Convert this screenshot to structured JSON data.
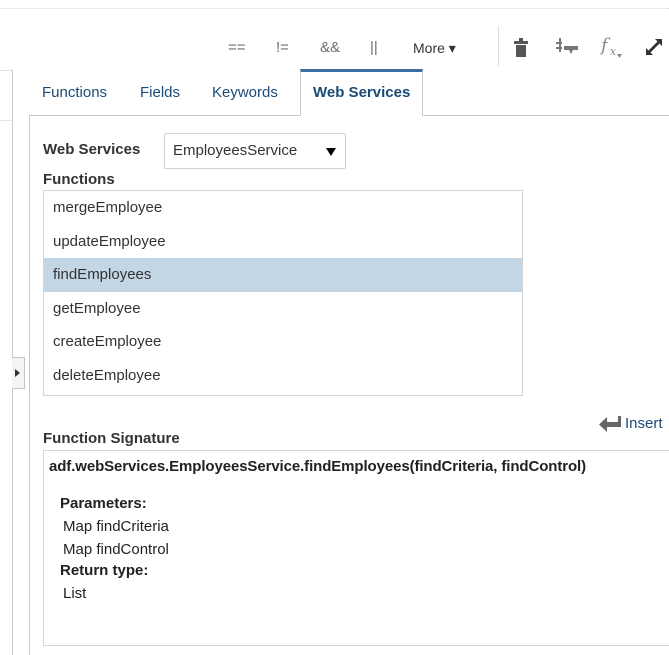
{
  "toolbar": {
    "eq": "==",
    "neq": "!=",
    "and": "&&",
    "or": "||",
    "more_label": "More ▾"
  },
  "tabs": [
    {
      "label": "Functions",
      "active": false
    },
    {
      "label": "Fields",
      "active": false
    },
    {
      "label": "Keywords",
      "active": false
    },
    {
      "label": "Web Services",
      "active": true
    }
  ],
  "web_services": {
    "label": "Web Services",
    "selected": "EmployeesService"
  },
  "functions": {
    "label": "Functions",
    "items": [
      {
        "name": "mergeEmployee",
        "selected": false
      },
      {
        "name": "updateEmployee",
        "selected": false
      },
      {
        "name": "findEmployees",
        "selected": true
      },
      {
        "name": "getEmployee",
        "selected": false
      },
      {
        "name": "createEmployee",
        "selected": false
      },
      {
        "name": "deleteEmployee",
        "selected": false
      }
    ]
  },
  "insert": {
    "label": "Insert"
  },
  "signature": {
    "label": "Function Signature",
    "text": "adf.webServices.EmployeesService.findEmployees(findCriteria, findControl)",
    "parameters_label": "Parameters:",
    "parameters": [
      "Map findCriteria",
      "Map findControl"
    ],
    "return_label": "Return type:",
    "return_type": "List"
  },
  "colors": {
    "accent": "#3a6fa3",
    "selection": "#c3d6e6",
    "link": "#1a4b77"
  }
}
